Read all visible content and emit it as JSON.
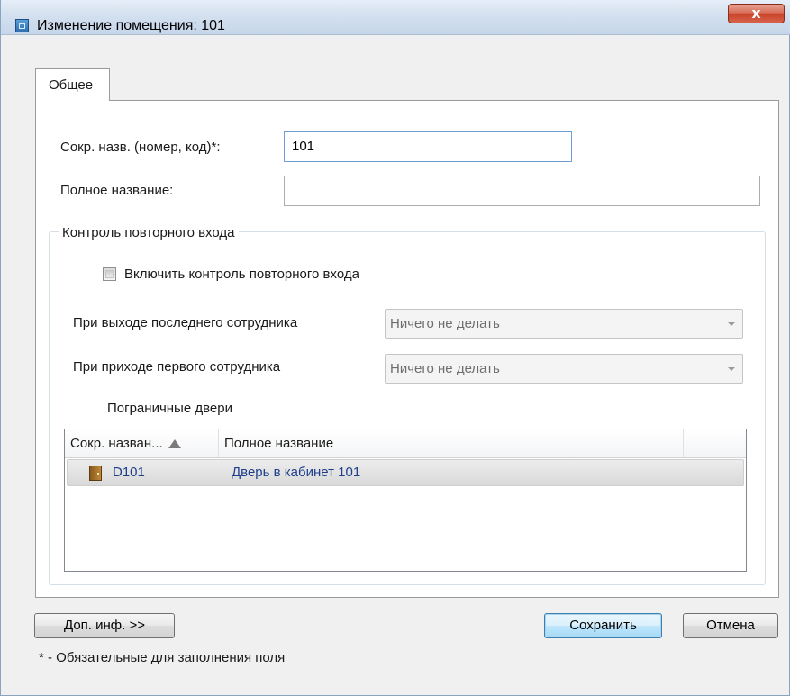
{
  "window": {
    "title": "Изменение помещения: 101",
    "close_label": "x",
    "icon": "room-app-icon"
  },
  "tabs": [
    {
      "label": "Общее",
      "selected": true
    }
  ],
  "form": {
    "short_name_label": "Сокр. назв. (номер, код)*:",
    "short_name_value": "101",
    "full_name_label": "Полное название:",
    "full_name_value": ""
  },
  "reentry": {
    "group_title": "Контроль повторного входа",
    "enable_checkbox_label": "Включить контроль повторного входа",
    "enable_checked": false,
    "last_exit_label": "При выходе последнего сотрудника",
    "last_exit_value": "Ничего не делать",
    "first_entry_label": "При приходе первого сотрудника",
    "first_entry_value": "Ничего не делать",
    "border_doors_label": "Пограничные двери"
  },
  "doors_table": {
    "columns": [
      "Сокр. назван...",
      "Полное название",
      ""
    ],
    "sort": {
      "column": 0,
      "direction": "ascending"
    },
    "rows": [
      {
        "icon": "door-icon",
        "short_name": "D101",
        "full_name": "Дверь в кабинет 101",
        "selected": true
      }
    ]
  },
  "buttons": {
    "more_info": "Доп. инф. >>",
    "save": "Сохранить",
    "cancel": "Отмена"
  },
  "footnote": "* - Обязательные для заполнения поля",
  "colors": {
    "link_text": "#1e3e8c",
    "default_button_border": "#3c7fb1",
    "close_button": "#c9452a"
  }
}
